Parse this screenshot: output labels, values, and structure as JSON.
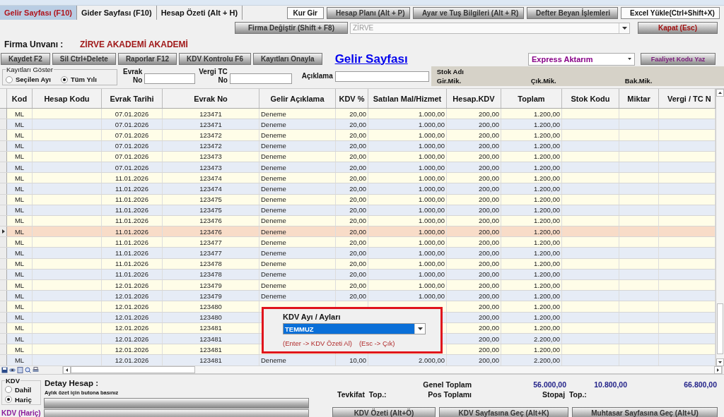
{
  "tabs": [
    {
      "label": "Gelir Sayfası (F10)",
      "selected": true
    },
    {
      "label": "Gider Sayfası (F10)",
      "selected": false
    },
    {
      "label": "Hesap Özeti (Alt + H)",
      "selected": false
    }
  ],
  "toolbar_buttons": [
    {
      "label": "Kur Gir",
      "kind": "flat"
    },
    {
      "label": "Hesap Planı (Alt + P)",
      "kind": "raised"
    },
    {
      "label": "Ayar ve Tuş Bilgileri (Alt + R)",
      "kind": "raised"
    },
    {
      "label": "Defter Beyan İşlemleri",
      "kind": "raised"
    },
    {
      "label": "Excel Yükle(Ctrl+Shift+X)",
      "kind": "flat"
    }
  ],
  "firm_change_button": "Firma Değiştir (Shift + F8)",
  "firm_combo": {
    "value": "ZİRVE",
    "disabled": true
  },
  "close_button": "Kapat (Esc)",
  "firm": {
    "label": "Firma Unvanı :",
    "value": "ZİRVE AKADEMİ AKADEMİ"
  },
  "action_buttons": [
    "Kaydet F2",
    "Sil Ctrl+Delete",
    "Raporlar F12",
    "KDV Kontrolu F6",
    "Kayıtları Onayla"
  ],
  "page_title": "Gelir Sayfası",
  "export_dropdown": {
    "value": "Express Aktarım"
  },
  "activity_button": "Faaliyet Kodu Yaz",
  "filter": {
    "group_label": "Kayıtları Göster",
    "options": [
      {
        "label": "Seçilen Ayı",
        "selected": false
      },
      {
        "label": "Tüm Yılı",
        "selected": true
      }
    ],
    "fields": [
      {
        "label_lines": [
          "Evrak",
          "No"
        ]
      },
      {
        "label_lines": [
          "Vergi TC",
          "No"
        ]
      },
      {
        "label_lines": [
          "Açıklama"
        ]
      }
    ]
  },
  "stock_panel": {
    "title": "Stok Adı",
    "columns": [
      "Gir.Mik.",
      "Çık.Mik.",
      "Bak.Mik."
    ]
  },
  "table": {
    "columns": [
      "Kod",
      "Hesap Kodu",
      "Evrak Tarihi",
      "Evrak No",
      "Gelir Açıklama",
      "KDV %",
      "Satılan Mal/Hizmet",
      "Hesap.KDV",
      "Toplam",
      "Stok Kodu",
      "Miktar",
      "Vergi / TC N"
    ],
    "rows": [
      {
        "selected": false,
        "cells": [
          "ML",
          null,
          "07.01.2026",
          "123471",
          "Deneme",
          "20,00",
          "1.000,00",
          "200,00",
          "1.200,00",
          null,
          null,
          null
        ]
      },
      {
        "selected": false,
        "cells": [
          "ML",
          null,
          "07.01.2026",
          "123471",
          "Deneme",
          "20,00",
          "1.000,00",
          "200,00",
          "1.200,00",
          null,
          null,
          null
        ]
      },
      {
        "selected": false,
        "cells": [
          "ML",
          null,
          "07.01.2026",
          "123472",
          "Deneme",
          "20,00",
          "1.000,00",
          "200,00",
          "1.200,00",
          null,
          null,
          null
        ]
      },
      {
        "selected": false,
        "cells": [
          "ML",
          null,
          "07.01.2026",
          "123472",
          "Deneme",
          "20,00",
          "1.000,00",
          "200,00",
          "1.200,00",
          null,
          null,
          null
        ]
      },
      {
        "selected": false,
        "cells": [
          "ML",
          null,
          "07.01.2026",
          "123473",
          "Deneme",
          "20,00",
          "1.000,00",
          "200,00",
          "1.200,00",
          null,
          null,
          null
        ]
      },
      {
        "selected": false,
        "cells": [
          "ML",
          null,
          "07.01.2026",
          "123473",
          "Deneme",
          "20,00",
          "1.000,00",
          "200,00",
          "1.200,00",
          null,
          null,
          null
        ]
      },
      {
        "selected": false,
        "cells": [
          "ML",
          null,
          "11.01.2026",
          "123474",
          "Deneme",
          "20,00",
          "1.000,00",
          "200,00",
          "1.200,00",
          null,
          null,
          null
        ]
      },
      {
        "selected": false,
        "cells": [
          "ML",
          null,
          "11.01.2026",
          "123474",
          "Deneme",
          "20,00",
          "1.000,00",
          "200,00",
          "1.200,00",
          null,
          null,
          null
        ]
      },
      {
        "selected": false,
        "cells": [
          "ML",
          null,
          "11.01.2026",
          "123475",
          "Deneme",
          "20,00",
          "1.000,00",
          "200,00",
          "1.200,00",
          null,
          null,
          null
        ]
      },
      {
        "selected": false,
        "cells": [
          "ML",
          null,
          "11.01.2026",
          "123475",
          "Deneme",
          "20,00",
          "1.000,00",
          "200,00",
          "1.200,00",
          null,
          null,
          null
        ]
      },
      {
        "selected": false,
        "cells": [
          "ML",
          null,
          "11.01.2026",
          "123476",
          "Deneme",
          "20,00",
          "1.000,00",
          "200,00",
          "1.200,00",
          null,
          null,
          null
        ]
      },
      {
        "selected": true,
        "cells": [
          "ML",
          null,
          "11.01.2026",
          "123476",
          "Deneme",
          "20,00",
          "1.000,00",
          "200,00",
          "1.200,00",
          null,
          null,
          null
        ]
      },
      {
        "selected": false,
        "cells": [
          "ML",
          null,
          "11.01.2026",
          "123477",
          "Deneme",
          "20,00",
          "1.000,00",
          "200,00",
          "1.200,00",
          null,
          null,
          null
        ]
      },
      {
        "selected": false,
        "cells": [
          "ML",
          null,
          "11.01.2026",
          "123477",
          "Deneme",
          "20,00",
          "1.000,00",
          "200,00",
          "1.200,00",
          null,
          null,
          null
        ]
      },
      {
        "selected": false,
        "cells": [
          "ML",
          null,
          "11.01.2026",
          "123478",
          "Deneme",
          "20,00",
          "1.000,00",
          "200,00",
          "1.200,00",
          null,
          null,
          null
        ]
      },
      {
        "selected": false,
        "cells": [
          "ML",
          null,
          "11.01.2026",
          "123478",
          "Deneme",
          "20,00",
          "1.000,00",
          "200,00",
          "1.200,00",
          null,
          null,
          null
        ]
      },
      {
        "selected": false,
        "cells": [
          "ML",
          null,
          "12.01.2026",
          "123479",
          "Deneme",
          "20,00",
          "1.000,00",
          "200,00",
          "1.200,00",
          null,
          null,
          null
        ]
      },
      {
        "selected": false,
        "cells": [
          "ML",
          null,
          "12.01.2026",
          "123479",
          "Deneme",
          "20,00",
          "1.000,00",
          "200,00",
          "1.200,00",
          null,
          null,
          null
        ]
      },
      {
        "selected": false,
        "cells": [
          "ML",
          null,
          "12.01.2026",
          "123480",
          null,
          null,
          null,
          "200,00",
          "1.200,00",
          null,
          null,
          null
        ]
      },
      {
        "selected": false,
        "cells": [
          "ML",
          null,
          "12.01.2026",
          "123480",
          null,
          null,
          null,
          "200,00",
          "1.200,00",
          null,
          null,
          null
        ]
      },
      {
        "selected": false,
        "cells": [
          "ML",
          null,
          "12.01.2026",
          "123481",
          null,
          null,
          null,
          "200,00",
          "1.200,00",
          null,
          null,
          null
        ]
      },
      {
        "selected": false,
        "cells": [
          "ML",
          null,
          "12.01.2026",
          "123481",
          null,
          null,
          null,
          "200,00",
          "2.200,00",
          null,
          null,
          null
        ]
      },
      {
        "selected": false,
        "cells": [
          "ML",
          null,
          "12.01.2026",
          "123481",
          null,
          null,
          null,
          "200,00",
          "1.200,00",
          null,
          null,
          null
        ]
      },
      {
        "selected": false,
        "cells": [
          "ML",
          null,
          "12.01.2026",
          "123481",
          "Deneme",
          "10,00",
          "2.000,00",
          "200,00",
          "2.200,00",
          null,
          null,
          null
        ]
      }
    ]
  },
  "month_popup": {
    "label": "KDV Ayı / Ayları",
    "value": "TEMMUZ",
    "hints": [
      "(Enter -> KDV Özeti Al)",
      "(Esc -> Çık)"
    ]
  },
  "kdv_group": {
    "label": "KDV",
    "options": [
      {
        "label": "Dahil",
        "selected": false
      },
      {
        "label": "Hariç",
        "selected": true
      }
    ],
    "status": "KDV (Hariç)"
  },
  "detail": {
    "title": "Detay Hesap :",
    "hint": "Aylık özet için butona basınız"
  },
  "totals": {
    "label": "Genel Toplam",
    "values": [
      "56.000,00",
      "10.800,00",
      "66.800,00"
    ]
  },
  "summary_labels": [
    "Tevkifat  Top.:",
    "Pos Toplamı",
    "Stopaj  Top.:"
  ],
  "bottom_buttons": [
    "KDV Özeti (Alt+Ö)",
    "KDV Sayfasına Geç (Alt+K)",
    "Muhtasar Sayfasına Geç (Alt+U)"
  ]
}
